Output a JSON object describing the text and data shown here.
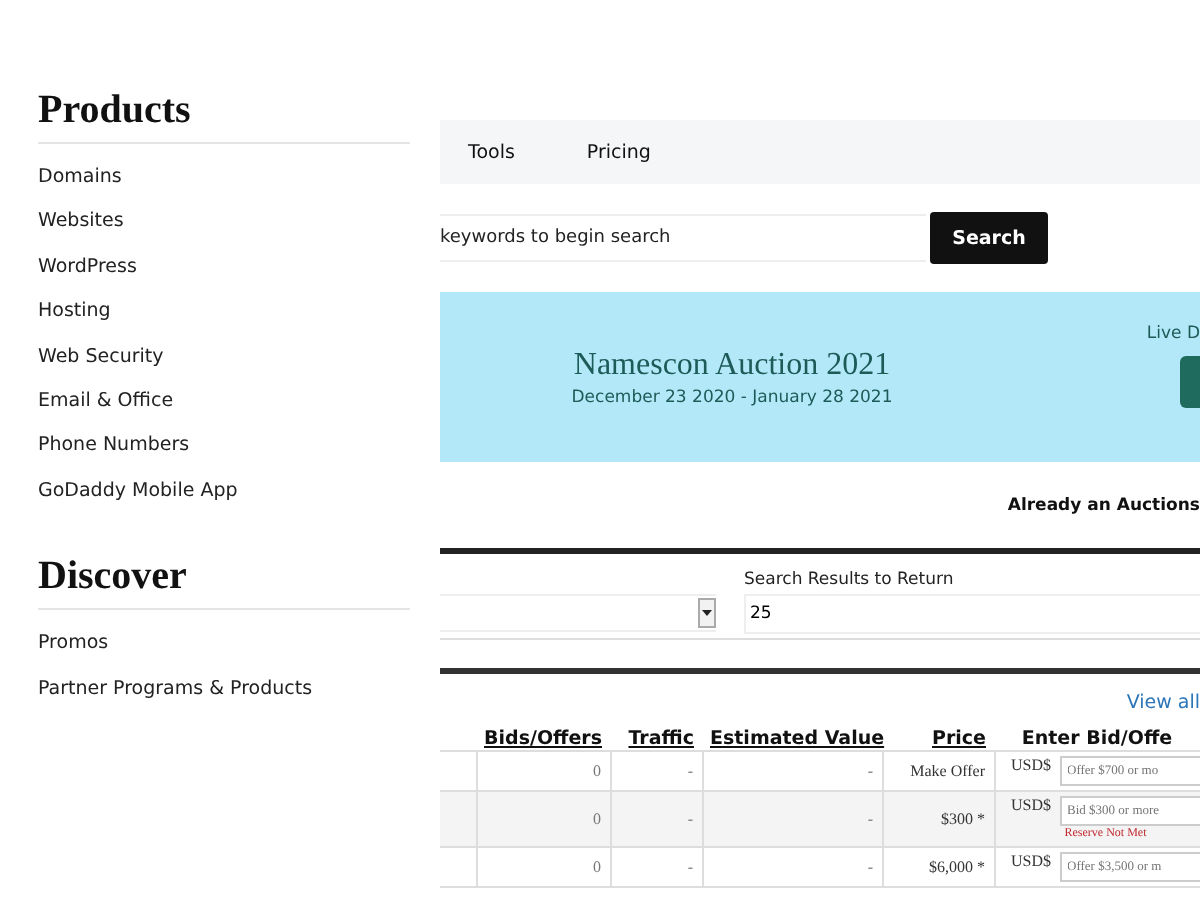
{
  "sidebar": {
    "sections": [
      {
        "title": "Products",
        "items": [
          "Domains",
          "Websites",
          "WordPress",
          "Hosting",
          "Web Security",
          "Email & Office",
          "Phone Numbers",
          "GoDaddy Mobile App"
        ]
      },
      {
        "title": "Discover",
        "items": [
          "Promos",
          "Partner Programs & Products"
        ]
      }
    ]
  },
  "nav": [
    "Tools",
    "Pricing"
  ],
  "search": {
    "placeholder": "keywords to begin search",
    "button": "Search"
  },
  "banner": {
    "title": "Namescon Auction 2021",
    "dates": "December 23 2020 - January 28 2021",
    "side_text": "Live D"
  },
  "account_text": "Already an Auctions",
  "filters": {
    "results_label": "Search Results to Return",
    "results_value": "25"
  },
  "view_all": "View all",
  "table": {
    "columns": [
      "Bids/Offers",
      "Traffic",
      "Estimated Value",
      "Price",
      "Enter Bid/Offe"
    ],
    "rows": [
      {
        "bids": "0",
        "traffic": "-",
        "value": "-",
        "price": "Make Offer",
        "currency": "USD$",
        "placeholder": "Offer $700 or mo",
        "reserve_note": ""
      },
      {
        "bids": "0",
        "traffic": "-",
        "value": "-",
        "price": "$300 *",
        "currency": "USD$",
        "placeholder": "Bid $300 or more",
        "reserve_note": "Reserve Not Met"
      },
      {
        "bids": "0",
        "traffic": "-",
        "value": "-",
        "price": "$6,000 *",
        "currency": "USD$",
        "placeholder": "Offer $3,500 or m",
        "reserve_note": ""
      }
    ]
  }
}
